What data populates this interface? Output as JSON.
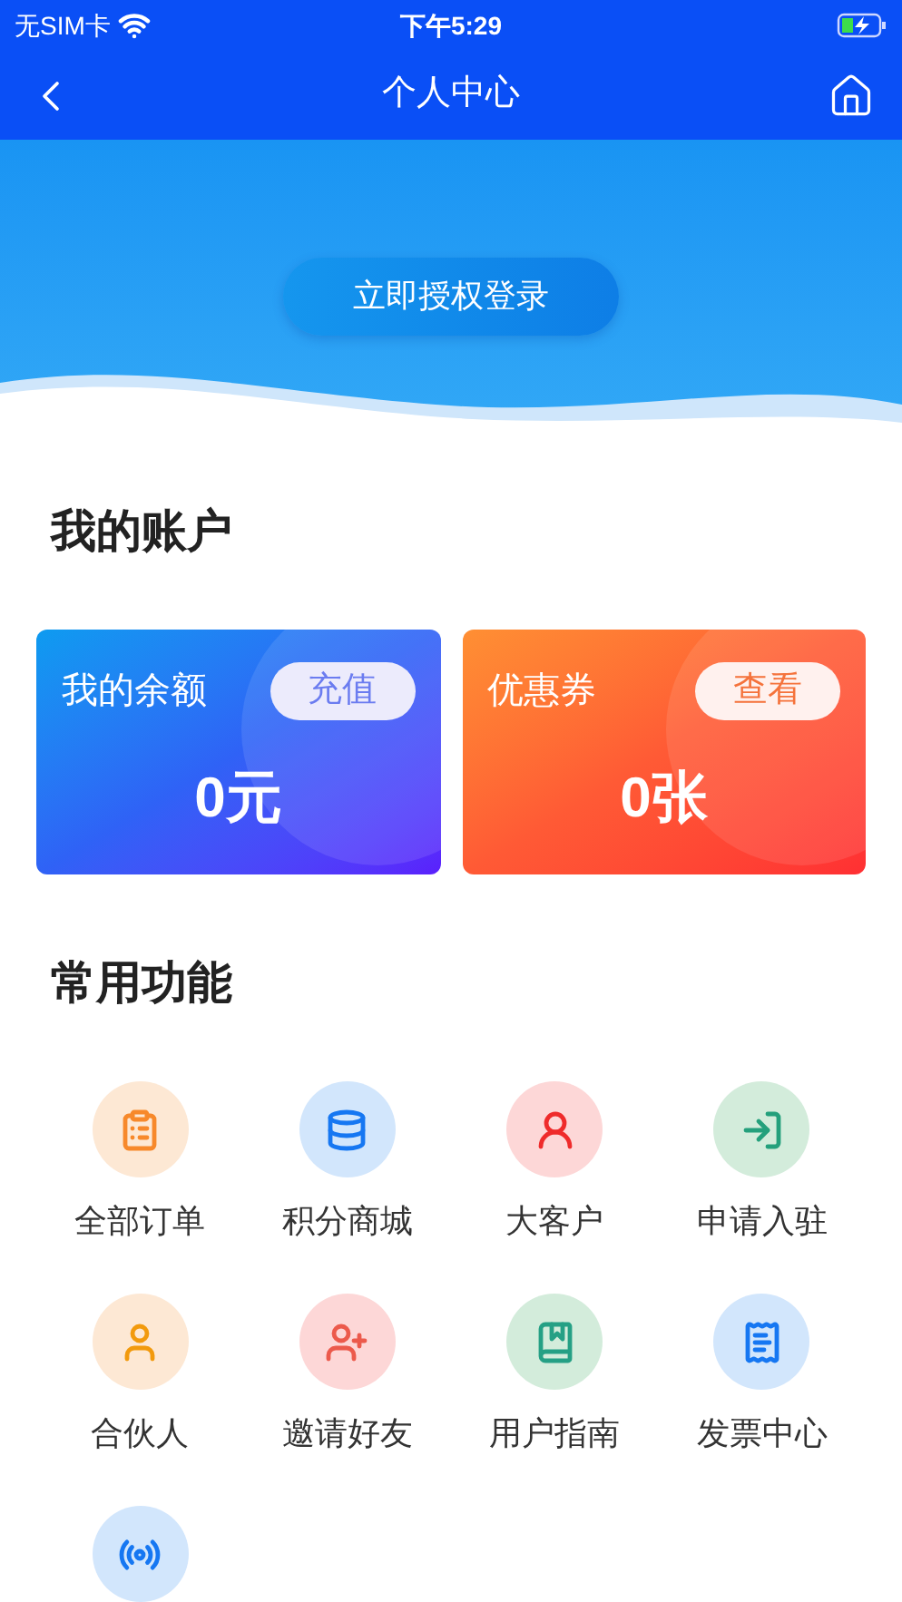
{
  "status_bar": {
    "carrier": "无SIM卡",
    "time": "下午5:29"
  },
  "nav": {
    "title": "个人中心"
  },
  "hero": {
    "login_button": "立即授权登录"
  },
  "account": {
    "title": "我的账户",
    "cards": [
      {
        "kind": "balance",
        "label": "我的余额",
        "action": "充值",
        "value": "0元"
      },
      {
        "kind": "coupon",
        "label": "优惠券",
        "action": "查看",
        "value": "0张"
      }
    ]
  },
  "features": {
    "title": "常用功能",
    "items": [
      {
        "kind": "orders",
        "label": "全部订单"
      },
      {
        "kind": "points",
        "label": "积分商城"
      },
      {
        "kind": "vip",
        "label": "大客户"
      },
      {
        "kind": "apply",
        "label": "申请入驻"
      },
      {
        "kind": "partner",
        "label": "合伙人"
      },
      {
        "kind": "invite",
        "label": "邀请好友"
      },
      {
        "kind": "guide",
        "label": "用户指南"
      },
      {
        "kind": "invoice",
        "label": "发票中心"
      },
      {
        "kind": "more"
      }
    ]
  }
}
